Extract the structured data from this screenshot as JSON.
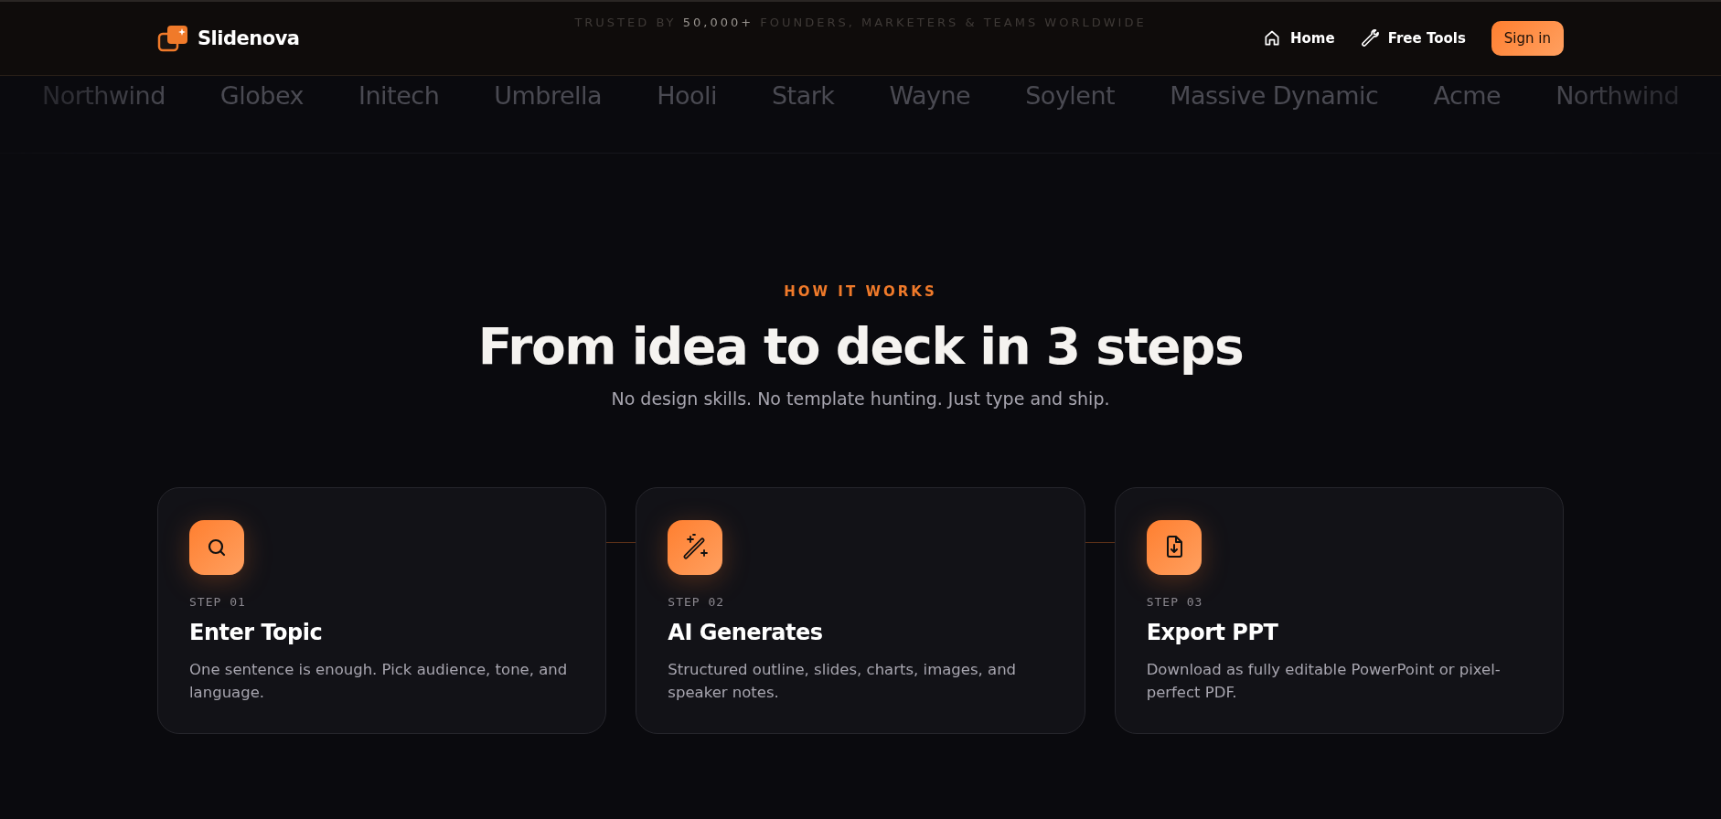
{
  "header": {
    "brand": "Slidenova",
    "trusted": {
      "prefix": "TRUSTED BY ",
      "highlight": "50,000+",
      "suffix": " FOUNDERS, MARKETERS & TEAMS WORLDWIDE"
    },
    "nav": [
      {
        "kind": "home",
        "label": "Home"
      },
      {
        "kind": "tools",
        "label": "Free Tools"
      }
    ],
    "signin": "Sign in"
  },
  "logos": [
    "Northwind",
    "Globex",
    "Initech",
    "Umbrella",
    "Hooli",
    "Stark",
    "Wayne",
    "Soylent",
    "Massive Dynamic",
    "Acme",
    "Northwind"
  ],
  "section": {
    "eyebrow": "HOW IT WORKS",
    "title": "From idea to deck in 3 steps",
    "subtitle": "No design skills. No template hunting. Just type and ship."
  },
  "steps": [
    {
      "kind": "search",
      "step": "STEP 01",
      "title": "Enter Topic",
      "text": "One sentence is enough. Pick audience, tone, and language."
    },
    {
      "kind": "wand",
      "step": "STEP 02",
      "title": "AI Generates",
      "text": "Structured outline, slides, charts, images, and speaker notes."
    },
    {
      "kind": "export",
      "step": "STEP 03",
      "title": "Export PPT",
      "text": "Download as fully editable PowerPoint or pixel-perfect PDF."
    }
  ]
}
